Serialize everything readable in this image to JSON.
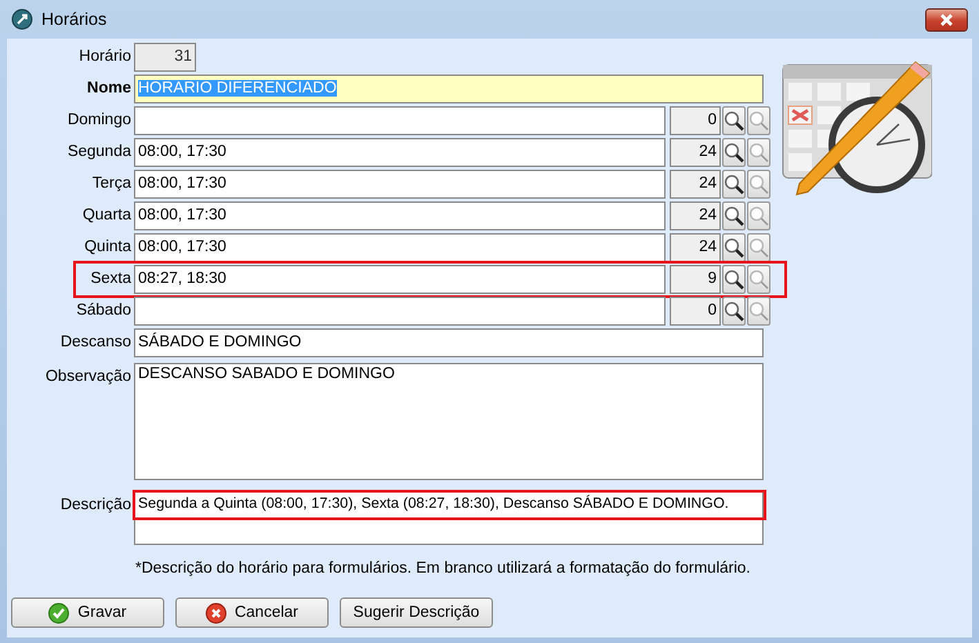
{
  "window": {
    "title": "Horários"
  },
  "horario": {
    "label": "Horário",
    "value": "31"
  },
  "nome": {
    "label": "Nome",
    "value": "HORARIO DIFERENCIADO",
    "text_selected": true
  },
  "days": [
    {
      "label": "Domingo",
      "count": "0",
      "highlighted": false
    },
    {
      "label": "Segunda",
      "value": "08:00, 17:30",
      "count": "24",
      "highlighted": false
    },
    {
      "label": "Terça",
      "value": "08:00, 17:30",
      "count": "24",
      "highlighted": false
    },
    {
      "label": "Quarta",
      "value": "08:00, 17:30",
      "count": "24",
      "highlighted": false
    },
    {
      "label": "Quinta",
      "value": "08:00, 17:30",
      "count": "24",
      "highlighted": false
    },
    {
      "label": "Sexta",
      "value": "08:27, 18:30",
      "count": "9",
      "highlighted": true
    },
    {
      "label": "Sábado",
      "count": "0",
      "highlighted": false
    }
  ],
  "descanso": {
    "label": "Descanso",
    "value": "SÁBADO E DOMINGO"
  },
  "observacao": {
    "label": "Observação",
    "value": "DESCANSO SABADO E DOMINGO"
  },
  "descricao": {
    "label": "Descrição",
    "value": "Segunda a Quinta (08:00, 17:30), Sexta (08:27, 18:30), Descanso SÁBADO E DOMINGO.",
    "highlighted": true
  },
  "note": "*Descrição do horário para formulários. Em branco utilizará a formatação do formulário.",
  "buttons": [
    {
      "label": "Gravar",
      "kind": "save"
    },
    {
      "label": "Cancelar",
      "kind": "cancel"
    },
    {
      "label": "Sugerir Descrição",
      "kind": "plain"
    }
  ]
}
